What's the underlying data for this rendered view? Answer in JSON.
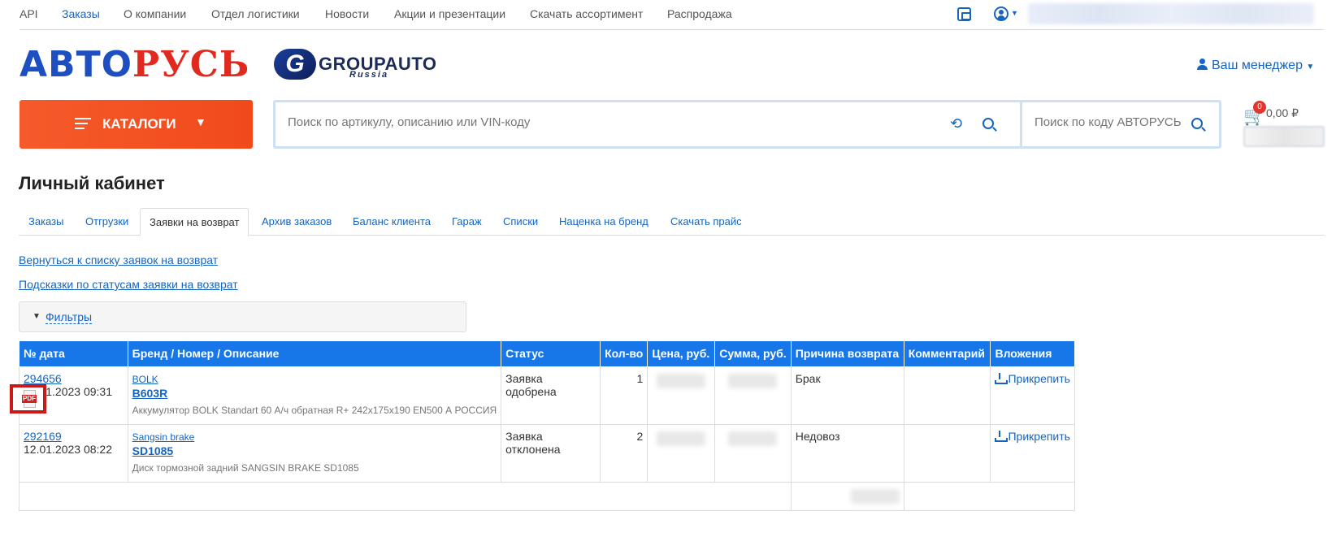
{
  "topnav": {
    "items": [
      {
        "label": "API",
        "active": false
      },
      {
        "label": "Заказы",
        "active": true
      },
      {
        "label": "О компании",
        "active": false
      },
      {
        "label": "Отдел логистики",
        "active": false
      },
      {
        "label": "Новости",
        "active": false
      },
      {
        "label": "Акции и презентации",
        "active": false
      },
      {
        "label": "Скачать ассортимент",
        "active": false
      },
      {
        "label": "Распродажа",
        "active": false
      }
    ],
    "icons": [
      "wallet-icon",
      "user-icon",
      "chevron-down-icon"
    ]
  },
  "header": {
    "logo_part1": "АВТО",
    "logo_part2": "РУСЬ",
    "partner_mark": "G",
    "partner_logo": "GROUPAUTO",
    "partner_sub": "Russia",
    "manager": "Ваш менеджер"
  },
  "catalog": {
    "label": "КАТАЛОГИ"
  },
  "search": {
    "main_placeholder": "Поиск по артикулу, описанию или VIN-коду",
    "code_placeholder": "Поиск по коду АВТОРУСЬ"
  },
  "cart": {
    "count": "0",
    "sum": "0,00 ₽"
  },
  "page": {
    "title": "Личный кабинет"
  },
  "tabs": [
    {
      "label": "Заказы",
      "active": false
    },
    {
      "label": "Отгрузки",
      "active": false
    },
    {
      "label": "Заявки на возврат",
      "active": true
    },
    {
      "label": "Архив заказов",
      "active": false
    },
    {
      "label": "Баланс клиента",
      "active": false
    },
    {
      "label": "Гараж",
      "active": false
    },
    {
      "label": "Списки",
      "active": false
    },
    {
      "label": "Наценка на бренд",
      "active": false
    },
    {
      "label": "Скачать прайс",
      "active": false
    }
  ],
  "links": {
    "back": "Вернуться к списку заявок на возврат",
    "hints": "Подсказки по статусам заявки на возврат"
  },
  "filters": {
    "label": "Фильтры"
  },
  "table": {
    "columns": [
      "№ дата",
      "Бренд / Номер / Описание",
      "Статус",
      "Кол-во",
      "Цена, руб.",
      "Сумма, руб.",
      "Причина возврата",
      "Комментарий",
      "Вложения"
    ],
    "rows": [
      {
        "number": "294656",
        "date": "16.01.2023 09:31",
        "brand": "BOLK",
        "part": "B603R",
        "description": "Аккумулятор BOLK Standart 60 А/ч обратная R+ 242х175х190 EN500 А РОССИЯ",
        "status": "Заявка одобрена",
        "qty": "1",
        "reason": "Брак",
        "comment": "",
        "attach": "Прикрепить"
      },
      {
        "number": "292169",
        "date": "12.01.2023 08:22",
        "brand": "Sangsin brake",
        "part": "SD1085",
        "description": "Диск тормозной задний SANGSIN BRAKE SD1085",
        "status": "Заявка отклонена",
        "qty": "2",
        "reason": "Недовоз",
        "comment": "",
        "attach": "Прикрепить"
      }
    ]
  },
  "pdf_icon": {
    "label": "PDF"
  }
}
